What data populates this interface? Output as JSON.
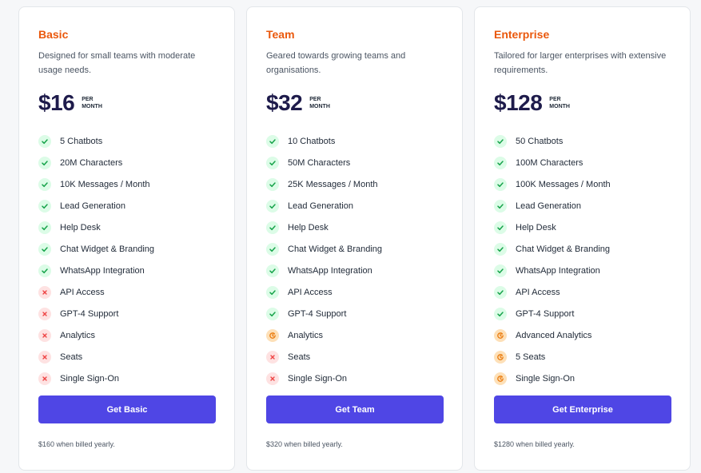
{
  "plans": [
    {
      "name": "Basic",
      "description": "Designed for small teams with moderate usage needs.",
      "price": "$16",
      "per_line1": "PER",
      "per_line2": "MONTH",
      "button": "Get Basic",
      "billed": "$160 when billed yearly.",
      "features": [
        {
          "label": "5 Chatbots",
          "status": "check"
        },
        {
          "label": "20M Characters",
          "status": "check"
        },
        {
          "label": "10K Messages / Month",
          "status": "check"
        },
        {
          "label": "Lead Generation",
          "status": "check"
        },
        {
          "label": "Help Desk",
          "status": "check"
        },
        {
          "label": "Chat Widget & Branding",
          "status": "check"
        },
        {
          "label": "WhatsApp Integration",
          "status": "check"
        },
        {
          "label": "API Access",
          "status": "cross"
        },
        {
          "label": "GPT-4 Support",
          "status": "cross"
        },
        {
          "label": "Analytics",
          "status": "cross"
        },
        {
          "label": "Seats",
          "status": "cross"
        },
        {
          "label": "Single Sign-On",
          "status": "cross"
        }
      ]
    },
    {
      "name": "Team",
      "description": "Geared towards growing teams and organisations.",
      "price": "$32",
      "per_line1": "PER",
      "per_line2": "MONTH",
      "button": "Get Team",
      "billed": "$320 when billed yearly.",
      "features": [
        {
          "label": "10 Chatbots",
          "status": "check"
        },
        {
          "label": "50M Characters",
          "status": "check"
        },
        {
          "label": "25K Messages / Month",
          "status": "check"
        },
        {
          "label": "Lead Generation",
          "status": "check"
        },
        {
          "label": "Help Desk",
          "status": "check"
        },
        {
          "label": "Chat Widget & Branding",
          "status": "check"
        },
        {
          "label": "WhatsApp Integration",
          "status": "check"
        },
        {
          "label": "API Access",
          "status": "check"
        },
        {
          "label": "GPT-4 Support",
          "status": "check"
        },
        {
          "label": "Analytics",
          "status": "clock"
        },
        {
          "label": "Seats",
          "status": "cross"
        },
        {
          "label": "Single Sign-On",
          "status": "cross"
        }
      ]
    },
    {
      "name": "Enterprise",
      "description": "Tailored for larger enterprises with extensive requirements.",
      "price": "$128",
      "per_line1": "PER",
      "per_line2": "MONTH",
      "button": "Get Enterprise",
      "billed": "$1280 when billed yearly.",
      "features": [
        {
          "label": "50 Chatbots",
          "status": "check"
        },
        {
          "label": "100M Characters",
          "status": "check"
        },
        {
          "label": "100K Messages / Month",
          "status": "check"
        },
        {
          "label": "Lead Generation",
          "status": "check"
        },
        {
          "label": "Help Desk",
          "status": "check"
        },
        {
          "label": "Chat Widget & Branding",
          "status": "check"
        },
        {
          "label": "WhatsApp Integration",
          "status": "check"
        },
        {
          "label": "API Access",
          "status": "check"
        },
        {
          "label": "GPT-4 Support",
          "status": "check"
        },
        {
          "label": "Advanced Analytics",
          "status": "clock"
        },
        {
          "label": "5 Seats",
          "status": "clock"
        },
        {
          "label": "Single Sign-On",
          "status": "clock"
        }
      ]
    }
  ],
  "colors": {
    "accent": "#4f46e5",
    "plan_name": "#ea580c",
    "price": "#1e1b4b",
    "check": "#16a34a",
    "cross": "#ef4444",
    "clock": "#ea7a0c"
  },
  "icons": {
    "check": "check-icon",
    "cross": "x-icon",
    "clock": "clock-icon"
  }
}
